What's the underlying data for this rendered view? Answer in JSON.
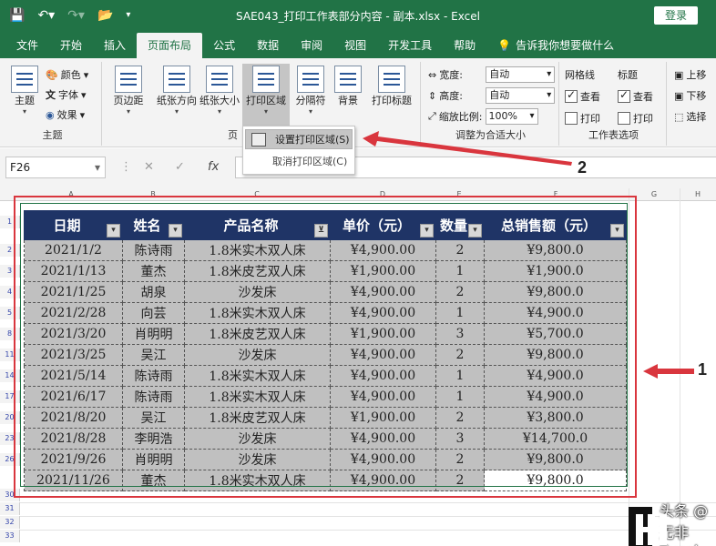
{
  "titlebar": {
    "filename": "SAE043_打印工作表部分内容 - 副本.xlsx",
    "separator": "-",
    "app": "Excel",
    "login": "登录"
  },
  "tabs": [
    "文件",
    "开始",
    "插入",
    "页面布局",
    "公式",
    "数据",
    "审阅",
    "视图",
    "开发工具",
    "帮助"
  ],
  "active_tab": "页面布局",
  "tell_me": "告诉我你想要做什么",
  "ribbon": {
    "themes": {
      "theme": "主题",
      "colors": "颜色",
      "fonts": "字体",
      "effects": "效果",
      "group": "主题"
    },
    "page_setup": {
      "margins": "页边距",
      "orientation": "纸张方向",
      "size": "纸张大小",
      "print_area": "打印区域",
      "breaks": "分隔符",
      "background": "背景",
      "print_titles": "打印标题",
      "group": "页"
    },
    "scale": {
      "width_label": "宽度:",
      "width_value": "自动",
      "height_label": "高度:",
      "height_value": "自动",
      "scale_label": "缩放比例:",
      "scale_value": "100%",
      "group": "调整为合适大小"
    },
    "sheet_options": {
      "gridlines": "网格线",
      "headings": "标题",
      "view": "查看",
      "print": "打印",
      "group": "工作表选项"
    },
    "arrange": {
      "up": "上移",
      "down": "下移",
      "select": "选择"
    }
  },
  "print_area_menu": {
    "set": "设置打印区域(S)",
    "clear": "取消打印区域(C)"
  },
  "formula_bar": {
    "name_box": "F26",
    "fx": "fx"
  },
  "columns": [
    "A",
    "B",
    "C",
    "D",
    "E",
    "F",
    "G",
    "H"
  ],
  "row_numbers": [
    "1",
    "2",
    "3",
    "4",
    "5",
    "8",
    "11",
    "14",
    "17",
    "20",
    "23",
    "26",
    "30",
    "31",
    "32",
    "33"
  ],
  "table": {
    "headers": [
      "日期",
      "姓名",
      "产品名称",
      "单价（元）",
      "数量",
      "总销售额（元）"
    ],
    "rows": [
      [
        "2021/1/2",
        "陈诗雨",
        "1.8米实木双人床",
        "¥4,900.00",
        "2",
        "¥9,800.0"
      ],
      [
        "2021/1/13",
        "董杰",
        "1.8米皮艺双人床",
        "¥1,900.00",
        "1",
        "¥1,900.0"
      ],
      [
        "2021/1/25",
        "胡泉",
        "沙发床",
        "¥4,900.00",
        "2",
        "¥9,800.0"
      ],
      [
        "2021/2/28",
        "向芸",
        "1.8米实木双人床",
        "¥4,900.00",
        "1",
        "¥4,900.0"
      ],
      [
        "2021/3/20",
        "肖明明",
        "1.8米皮艺双人床",
        "¥1,900.00",
        "3",
        "¥5,700.0"
      ],
      [
        "2021/3/25",
        "吴江",
        "沙发床",
        "¥4,900.00",
        "2",
        "¥9,800.0"
      ],
      [
        "2021/5/14",
        "陈诗雨",
        "1.8米实木双人床",
        "¥4,900.00",
        "1",
        "¥4,900.0"
      ],
      [
        "2021/6/17",
        "陈诗雨",
        "1.8米实木双人床",
        "¥4,900.00",
        "1",
        "¥4,900.0"
      ],
      [
        "2021/8/20",
        "吴江",
        "1.8米皮艺双人床",
        "¥1,900.00",
        "2",
        "¥3,800.0"
      ],
      [
        "2021/8/28",
        "李明浩",
        "沙发床",
        "¥4,900.00",
        "3",
        "¥14,700.0"
      ],
      [
        "2021/9/26",
        "肖明明",
        "沙发床",
        "¥4,900.00",
        "2",
        "¥9,800.0"
      ],
      [
        "2021/11/26",
        "董杰",
        "1.8米实木双人床",
        "¥4,900.00",
        "2",
        "¥9,800.0"
      ]
    ]
  },
  "annotations": {
    "label1": "1",
    "label2": "2",
    "arrow_color": "#d9363e"
  },
  "watermark": "头条 @无非Excel",
  "colors": {
    "excel_green": "#217346",
    "header_navy": "#1f3466",
    "cell_gray": "#c0c0c0"
  }
}
